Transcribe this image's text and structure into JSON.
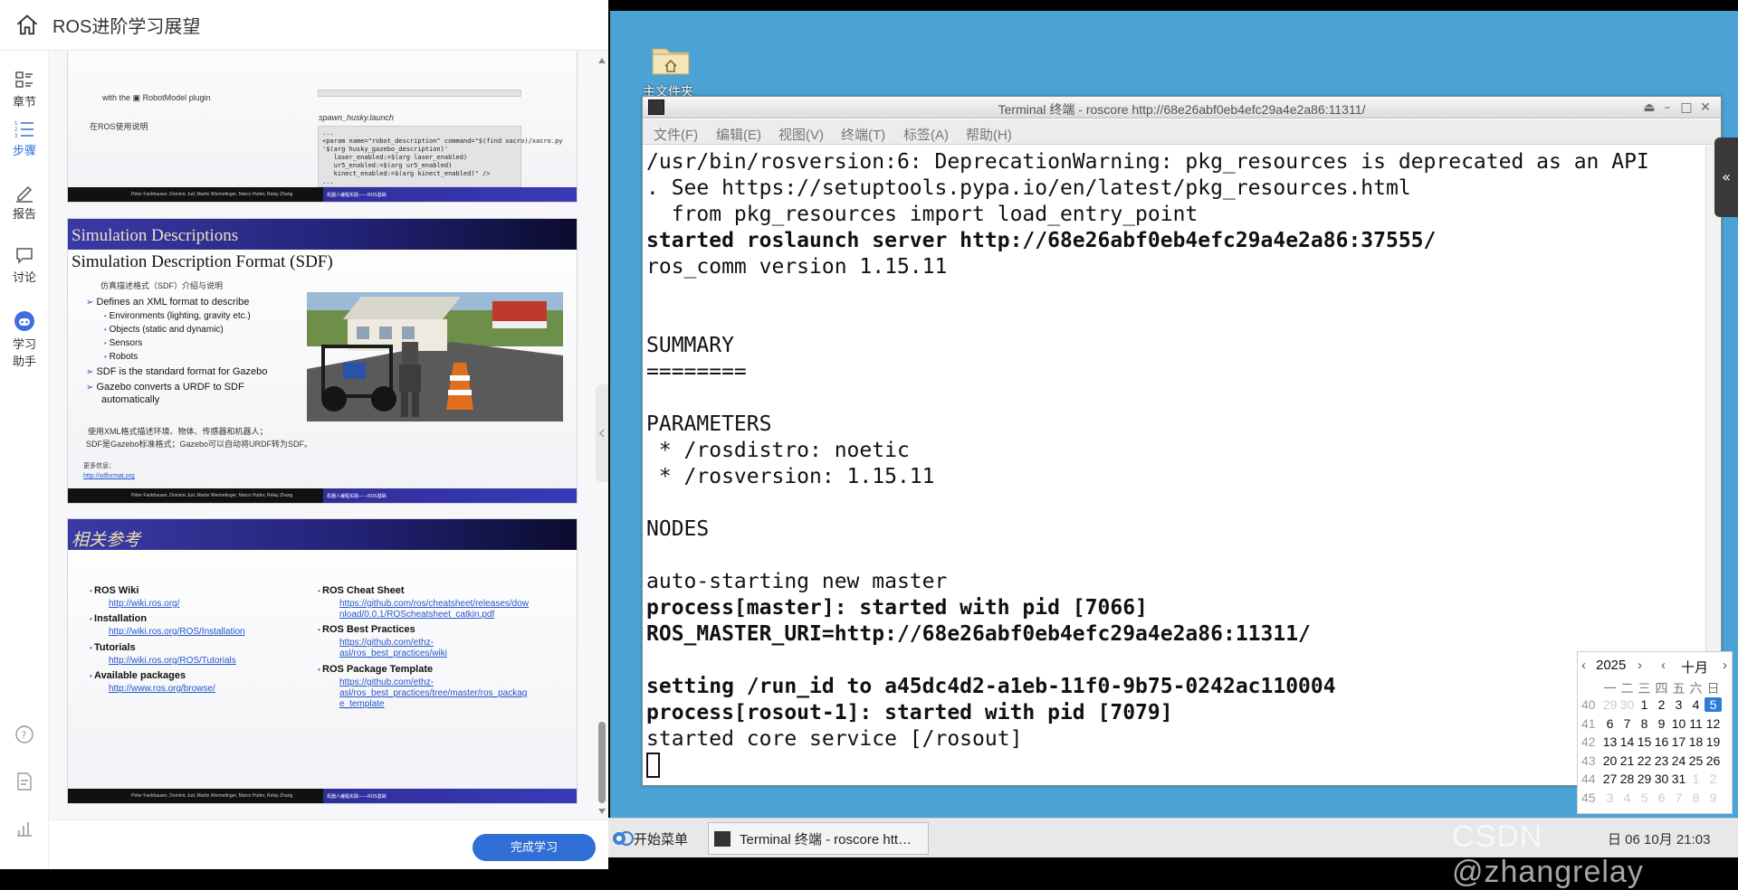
{
  "header": {
    "title": "ROS进阶学习展望"
  },
  "sidenav": {
    "items": [
      {
        "label": "章节"
      },
      {
        "label": "步骤"
      },
      {
        "label": "报告"
      },
      {
        "label": "讨论"
      },
      {
        "label_line1": "学习",
        "label_line2": "助手"
      }
    ],
    "active": "步骤"
  },
  "slide1": {
    "top_text": "with the",
    "top_text_plugin": "RobotModel plugin",
    "ros_usage": "在ROS使用说明",
    "file_name": "spawn_husky.launch",
    "code": "...\n<param name=\"robot_description\" command=\"$(find xacro)/xacro.py\n'$(arg husky_gazebo_description)'\n   laser_enabled:=$(arg laser_enabled)\n   ur5_enabled:=$(arg ur5_enabled)\n   kinect_enabled:=$(arg kinect_enabled)\" />\n...",
    "footer_left": "Péter Fankhauser, Dominic Jud, Martin Wermelinger, Marco Hutter, Relay Zhang",
    "footer_right": "机器人编程实践——ROS基础"
  },
  "slide2": {
    "band_title": "Simulation Descriptions",
    "title": "Simulation Description Format (SDF)",
    "subtitle_cn": "仿真描述格式（SDF）介绍与说明",
    "bullets": [
      {
        "level": 1,
        "text": "Defines an XML format to describe"
      },
      {
        "level": 2,
        "text": "Environments (lighting, gravity etc.)"
      },
      {
        "level": 2,
        "text": "Objects (static and dynamic)"
      },
      {
        "level": 2,
        "text": "Sensors"
      },
      {
        "level": 2,
        "text": "Robots"
      },
      {
        "level": 1,
        "text": "SDF is the standard format for Gazebo"
      },
      {
        "level": 1,
        "text": "Gazebo converts a URDF to SDF"
      },
      {
        "level": 1,
        "text": "automatically"
      }
    ],
    "note_line1": "使用XML格式描述环境、物体、传感器和机器人；",
    "note_line2": "SDF是Gazebo标准格式；Gazebo可以自动将URDF转为SDF。",
    "more_info": "更多信息：",
    "more_link": "http://sdformat.org",
    "footer_left": "Péter Fankhauser, Dominic Jud, Martin Wermelinger, Marco Hutter, Relay Zhang",
    "footer_right": "机器人编程实践——ROS基础"
  },
  "slide3": {
    "band_title": "相关参考",
    "left": [
      {
        "head": "ROS Wiki",
        "links": [
          "http://wiki.ros.org/"
        ]
      },
      {
        "head": "Installation",
        "links": [
          "http://wiki.ros.org/ROS/Installation"
        ]
      },
      {
        "head": "Tutorials",
        "links": [
          "http://wiki.ros.org/ROS/Tutorials"
        ]
      },
      {
        "head": "Available packages",
        "links": [
          "http://www.ros.org/browse/"
        ]
      }
    ],
    "right": [
      {
        "head": "ROS Cheat Sheet",
        "links": [
          "https://github.com/ros/cheatsheet/releases/dow",
          "nload/0.0.1/ROScheatsheet_catkin.pdf"
        ]
      },
      {
        "head": "ROS Best Practices",
        "links": [
          "https://github.com/ethz-",
          "asl/ros_best_practices/wiki"
        ]
      },
      {
        "head": "ROS Package Template",
        "links": [
          "https://github.com/ethz-",
          "asl/ros_best_practices/tree/master/ros_packag",
          "e_template"
        ]
      }
    ],
    "footer_left": "Péter Fankhauser, Dominic Jud, Martin Wermelinger, Marco Hutter, Relay Zhang",
    "footer_right": "机器人编程实践——ROS基础"
  },
  "complete_button": "完成学习",
  "desktop": {
    "home_folder_label": "主文件夹",
    "terminal": {
      "title": "Terminal 终端 - roscore http://68e26abf0eb4efc29a4e2a86:11311/",
      "menu": [
        "文件(F)",
        "编辑(E)",
        "视图(V)",
        "终端(T)",
        "标签(A)",
        "帮助(H)"
      ],
      "lines": [
        {
          "text": "/usr/bin/rosversion:6: DeprecationWarning: pkg_resources is deprecated as an API",
          "bold": false
        },
        {
          "text": ". See https://setuptools.pypa.io/en/latest/pkg_resources.html",
          "bold": false
        },
        {
          "text": "  from pkg_resources import load_entry_point",
          "bold": false
        },
        {
          "text": "started roslaunch server http://68e26abf0eb4efc29a4e2a86:37555/",
          "bold": true
        },
        {
          "text": "ros_comm version 1.15.11",
          "bold": false
        },
        {
          "text": "",
          "bold": false
        },
        {
          "text": "",
          "bold": false
        },
        {
          "text": "SUMMARY",
          "bold": false
        },
        {
          "text": "========",
          "bold": false
        },
        {
          "text": "",
          "bold": false
        },
        {
          "text": "PARAMETERS",
          "bold": false
        },
        {
          "text": " * /rosdistro: noetic",
          "bold": false
        },
        {
          "text": " * /rosversion: 1.15.11",
          "bold": false
        },
        {
          "text": "",
          "bold": false
        },
        {
          "text": "NODES",
          "bold": false
        },
        {
          "text": "",
          "bold": false
        },
        {
          "text": "auto-starting new master",
          "bold": false
        },
        {
          "text": "process[master]: started with pid [7066]",
          "bold": true
        },
        {
          "text": "ROS_MASTER_URI=http://68e26abf0eb4efc29a4e2a86:11311/",
          "bold": true
        },
        {
          "text": "",
          "bold": false
        },
        {
          "text": "setting /run_id to a45dc4d2-a1eb-11f0-9b75-0242ac110004",
          "bold": true
        },
        {
          "text": "process[rosout-1]: started with pid [7079]",
          "bold": true
        },
        {
          "text": "started core service [/rosout]",
          "bold": false
        }
      ]
    },
    "calendar": {
      "year": "2025",
      "month": "十月",
      "weekdays": [
        "一",
        "二",
        "三",
        "四",
        "五",
        "六",
        "日"
      ],
      "weeks": [
        {
          "wk": "40",
          "days": [
            "29",
            "30",
            "1",
            "2",
            "3",
            "4",
            "5"
          ],
          "other": [
            true,
            true,
            false,
            false,
            false,
            false,
            false
          ]
        },
        {
          "wk": "41",
          "days": [
            "6",
            "7",
            "8",
            "9",
            "10",
            "11",
            "12"
          ],
          "other": [
            false,
            false,
            false,
            false,
            false,
            false,
            false
          ]
        },
        {
          "wk": "42",
          "days": [
            "13",
            "14",
            "15",
            "16",
            "17",
            "18",
            "19"
          ],
          "other": [
            false,
            false,
            false,
            false,
            false,
            false,
            false
          ]
        },
        {
          "wk": "43",
          "days": [
            "20",
            "21",
            "22",
            "23",
            "24",
            "25",
            "26"
          ],
          "other": [
            false,
            false,
            false,
            false,
            false,
            false,
            false
          ]
        },
        {
          "wk": "44",
          "days": [
            "27",
            "28",
            "29",
            "30",
            "31",
            "1",
            "2"
          ],
          "other": [
            false,
            false,
            false,
            false,
            false,
            true,
            true
          ]
        },
        {
          "wk": "45",
          "days": [
            "3",
            "4",
            "5",
            "6",
            "7",
            "8",
            "9"
          ],
          "other": [
            true,
            true,
            true,
            true,
            true,
            true,
            true
          ]
        }
      ],
      "today": "5"
    },
    "taskbar": {
      "start": "开始菜单",
      "task_terminal": "Terminal 终端 - roscore htt…",
      "clock": "日 06 10月 21:03"
    },
    "watermark": "CSDN @zhangrelay"
  }
}
